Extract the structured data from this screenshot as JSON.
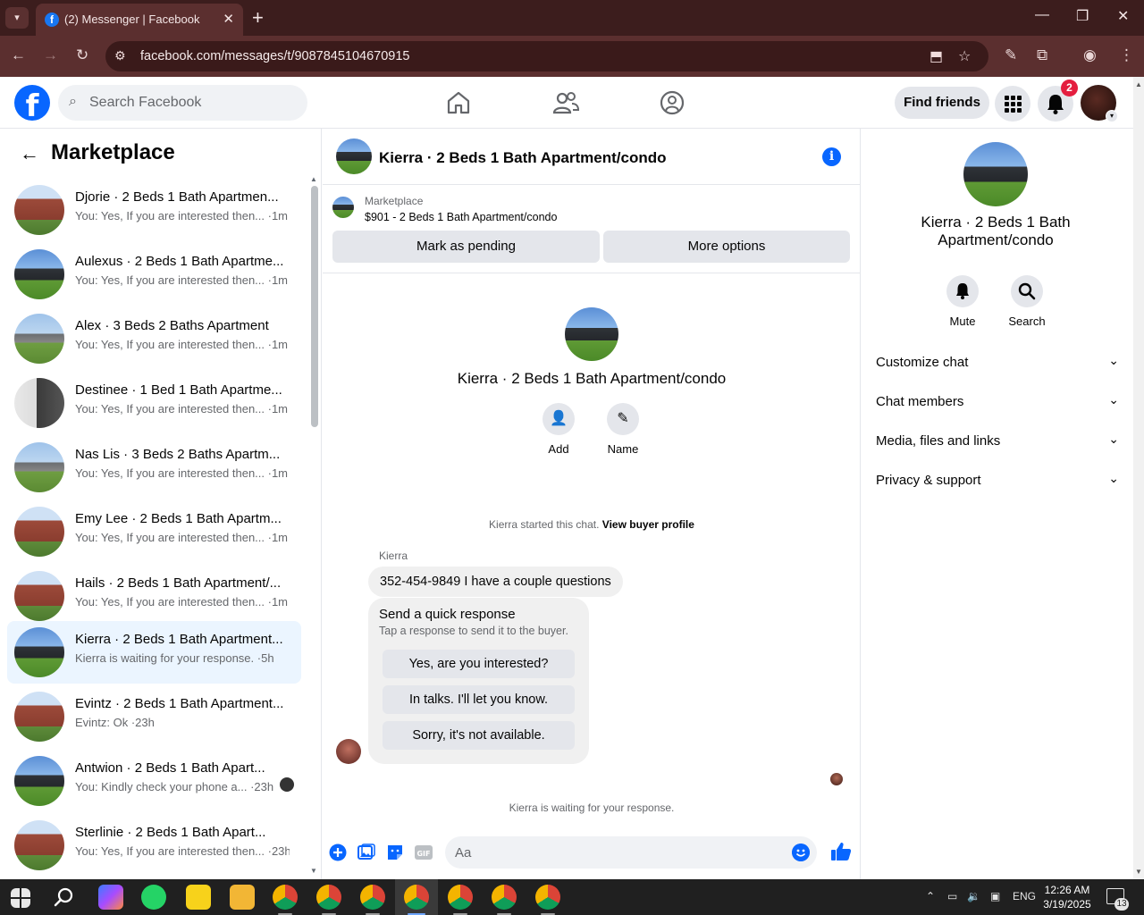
{
  "browser": {
    "tab_title": "(2) Messenger | Facebook",
    "url": "facebook.com/messages/t/9087845104670915",
    "new_tab": "+",
    "close_tab": "✕"
  },
  "fb": {
    "search_placeholder": "Search Facebook",
    "find_friends": "Find friends",
    "notif_count": "2"
  },
  "sidebar": {
    "title": "Marketplace",
    "conversations": [
      {
        "name": "Djorie · 2 Beds 1 Bath Apartmen...",
        "preview": "You: Yes, If you are interested then... ·1m"
      },
      {
        "name": "Aulexus · 2 Beds 1 Bath Apartme...",
        "preview": "You: Yes, If you are interested then... ·1m"
      },
      {
        "name": "Alex · 3 Beds 2 Baths Apartment",
        "preview": "You: Yes, If you are interested then... ·1m"
      },
      {
        "name": "Destinee · 1 Bed 1 Bath Apartme...",
        "preview": "You: Yes, If you are interested then... ·1m"
      },
      {
        "name": "Nas Lis · 3 Beds 2 Baths Apartm...",
        "preview": "You: Yes, If you are interested then... ·1m"
      },
      {
        "name": "Emy Lee · 2 Beds 1 Bath Apartm...",
        "preview": "You: Yes, If you are interested then... ·1m"
      },
      {
        "name": "Hails · 2 Beds 1 Bath Apartment/...",
        "preview": "You: Yes, If you are interested then... ·1m"
      },
      {
        "name": "Kierra · 2 Beds 1 Bath Apartment...",
        "preview": "Kierra is waiting for your response. ·5h"
      },
      {
        "name": "Evintz · 2 Beds 1 Bath Apartment...",
        "preview": "Evintz: Ok ·23h"
      },
      {
        "name": "Antwion · 2 Beds 1 Bath Apart...",
        "preview": "You: Kindly check your phone a... ·23h"
      },
      {
        "name": "Sterlinie · 2 Beds 1 Bath Apart...",
        "preview": "You: Yes, If you are interested then... ·23h"
      }
    ]
  },
  "chat": {
    "title": "Kierra · 2 Beds 1 Bath Apartment/condo",
    "marketplace_label": "Marketplace",
    "listing": "$901 - 2 Beds 1 Bath Apartment/condo",
    "mark_pending": "Mark as pending",
    "more_options": "More options",
    "intro_name": "Kierra · 2 Beds 1 Bath Apartment/condo",
    "add_label": "Add",
    "name_label": "Name",
    "started_text": "Kierra started this chat.",
    "view_buyer": "View buyer profile",
    "sender": "Kierra",
    "message": "352-454-9849 I have a couple questions",
    "quick_title": "Send a quick response",
    "quick_sub": "Tap a response to send it to the buyer.",
    "quick_options": [
      "Yes, are you interested?",
      "In talks. I'll let you know.",
      "Sorry, it's not available."
    ],
    "waiting": "Kierra is waiting for your response.",
    "composer_placeholder": "Aa"
  },
  "details": {
    "name": "Kierra · 2 Beds 1 Bath Apartment/condo",
    "mute": "Mute",
    "search": "Search",
    "sections": [
      "Customize chat",
      "Chat members",
      "Media, files and links",
      "Privacy & support"
    ]
  },
  "taskbar": {
    "lang": "ENG",
    "time": "12:26 AM",
    "date": "3/19/2025",
    "notif": "13"
  },
  "colors": {
    "fb_blue": "#0866ff",
    "chrome_dark": "#3c1d1d",
    "chrome_mid": "#5b2f2f",
    "badge_red": "#e41e3f"
  }
}
